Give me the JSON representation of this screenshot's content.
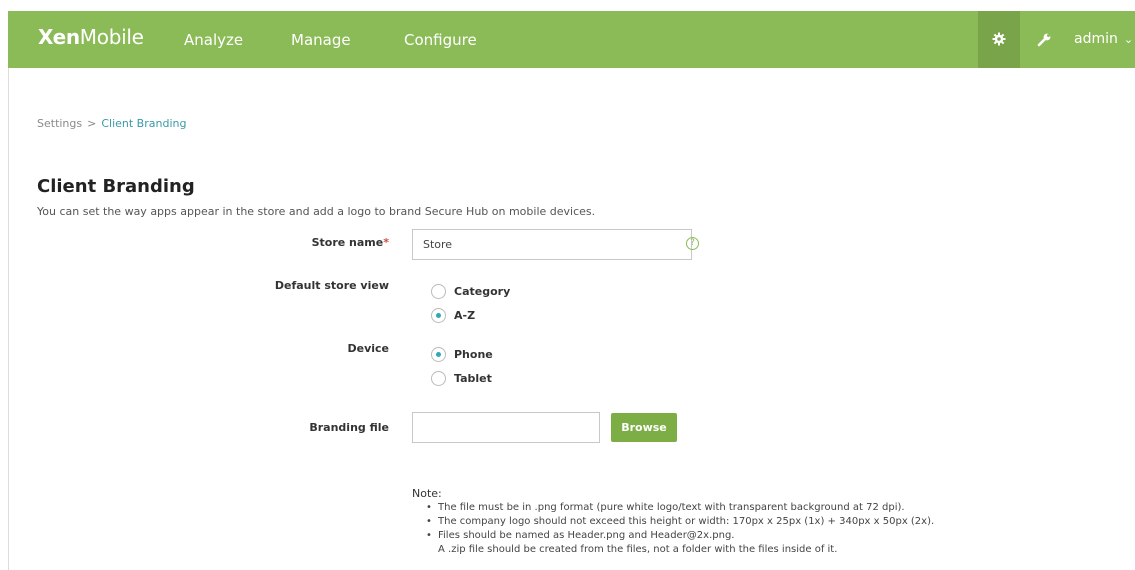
{
  "header": {
    "brand_bold": "Xen",
    "brand_light": "Mobile",
    "nav": [
      "Analyze",
      "Manage",
      "Configure"
    ],
    "settings_icon": "gear-icon",
    "tools_icon": "wrench-icon",
    "user_label": "admin",
    "user_menu_icon": "chevron-down-icon"
  },
  "breadcrumb": {
    "root": "Settings",
    "separator": ">",
    "current": "Client Branding"
  },
  "page": {
    "title": "Client Branding",
    "description": "You can set the way apps appear in the store and add a logo to brand Secure Hub on mobile devices."
  },
  "form": {
    "store_name": {
      "label": "Store name",
      "required_mark": "*",
      "value": "Store",
      "help_glyph": "?"
    },
    "default_store_view": {
      "label": "Default store view",
      "options": [
        "Category",
        "A-Z"
      ],
      "selected": "A-Z"
    },
    "device": {
      "label": "Device",
      "options": [
        "Phone",
        "Tablet"
      ],
      "selected": "Phone"
    },
    "branding_file": {
      "label": "Branding file",
      "value": "",
      "browse_label": "Browse"
    }
  },
  "note": {
    "title": "Note:",
    "items": [
      "The file must be in .png format (pure white logo/text with transparent background at 72 dpi).",
      "The company logo should not exceed this height or width: 170px x 25px (1x) + 340px x 50px (2x).",
      "Files should be named as Header.png and Header@2x.png."
    ],
    "item_3_extra": "A .zip file should be created from the files, not a folder with the files inside of it."
  },
  "colors": {
    "header_bg": "#8bbb57",
    "header_active_bg": "#7aa449",
    "accent_link": "#3a99a8",
    "button_bg": "#7cae45",
    "radio_selected": "#2ea9b8",
    "required": "#d24c3c"
  }
}
